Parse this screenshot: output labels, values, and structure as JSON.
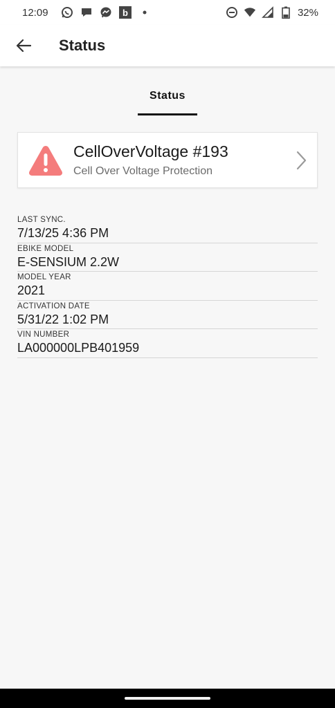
{
  "status_bar": {
    "time": "12:09",
    "battery": "32%",
    "icons": [
      "whatsapp-icon",
      "chat-icon",
      "messenger-icon",
      "b-app-icon",
      "notification-dot-icon",
      "dnd-icon",
      "wifi-icon",
      "signal-icon",
      "battery-icon"
    ],
    "b_glyph": "b"
  },
  "app_bar": {
    "title": "Status"
  },
  "tabs": [
    {
      "label": "Status",
      "active": true
    }
  ],
  "alert": {
    "title": "CellOverVoltage #193",
    "subtitle": "Cell Over Voltage Protection",
    "icon": "warning-triangle-icon",
    "color": "#f47c7c"
  },
  "info": [
    {
      "label": "LAST SYNC.",
      "value": "7/13/25 4:36 PM"
    },
    {
      "label": "EBIKE MODEL",
      "value": "E-SENSIUM 2.2W"
    },
    {
      "label": "MODEL YEAR",
      "value": "2021"
    },
    {
      "label": "ACTIVATION DATE",
      "value": "5/31/22 1:02 PM"
    },
    {
      "label": "VIN NUMBER",
      "value": "LA000000LPB401959"
    }
  ]
}
